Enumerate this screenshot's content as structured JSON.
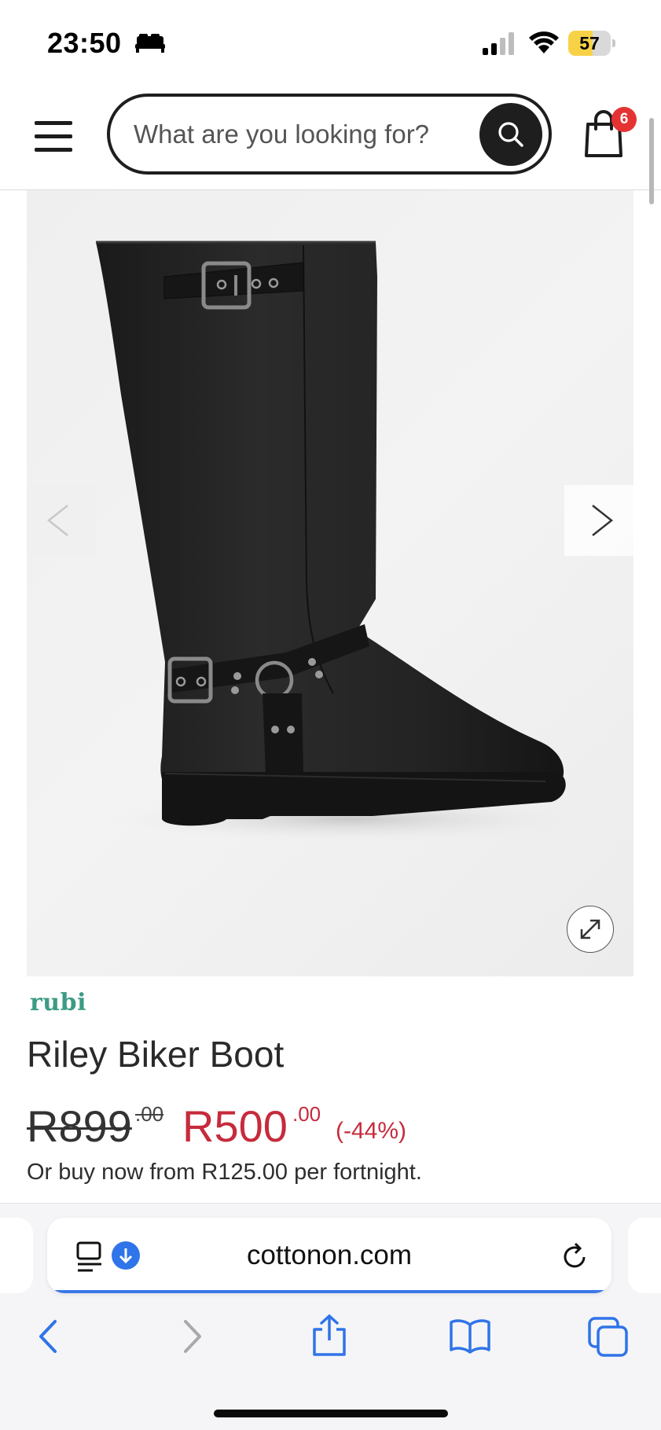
{
  "status_bar": {
    "time": "23:50",
    "battery_level": "57",
    "battery_fraction": 0.57,
    "icons": [
      "sleep-mode-icon",
      "cellular-signal-icon",
      "wifi-icon",
      "battery-icon"
    ]
  },
  "header": {
    "search_placeholder": "What are you looking for?",
    "cart_count": "6",
    "icons": [
      "menu-icon",
      "search-icon",
      "shopping-bag-icon"
    ]
  },
  "product": {
    "image_alt": "Black knee-high biker boot with buckle straps",
    "brand": "rubi",
    "title": "Riley Biker Boot",
    "old_price_main": "R899",
    "old_price_cents": ".00",
    "new_price_main": "R500",
    "new_price_cents": ".00",
    "discount": "(-44%)",
    "installment_text": "Or buy now from R125.00 per fortnight.",
    "icons": [
      "chevron-left-icon",
      "chevron-right-icon",
      "expand-icon"
    ]
  },
  "browser": {
    "url": "cottonon.com",
    "icons": [
      "reader-icon",
      "download-icon",
      "reload-icon",
      "back-icon",
      "forward-icon",
      "share-icon",
      "bookmarks-icon",
      "tabs-icon"
    ]
  },
  "colors": {
    "brand_green": "#3d9b85",
    "sale_red": "#c62b3c",
    "badge_red": "#e53232",
    "link_blue": "#2f74e8"
  }
}
